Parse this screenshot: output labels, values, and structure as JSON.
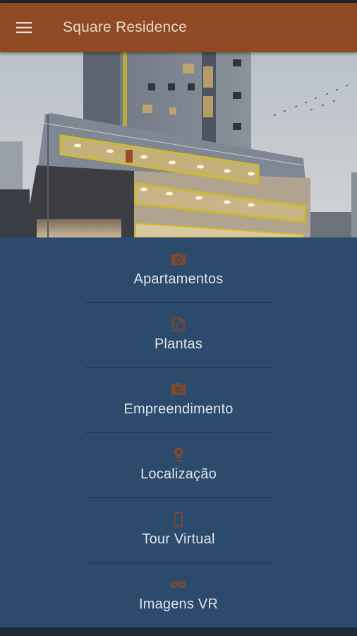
{
  "app": {
    "title": "Square Residence"
  },
  "colors": {
    "appbar": "#8f4a24",
    "menu_background": "#2c4a6c",
    "icon_accent": "#8a4b2a",
    "label_text": "#dfe5ec"
  },
  "menu": {
    "items": [
      {
        "label": "Apartamentos",
        "icon": "camera-icon"
      },
      {
        "label": "Plantas",
        "icon": "floorplan-icon"
      },
      {
        "label": "Empreendimento",
        "icon": "camera-icon"
      },
      {
        "label": "Localização",
        "icon": "location-pin-icon"
      },
      {
        "label": "Tour Virtual",
        "icon": "smartphone-icon"
      },
      {
        "label": "Imagens VR",
        "icon": "vr-headset-icon"
      }
    ]
  }
}
